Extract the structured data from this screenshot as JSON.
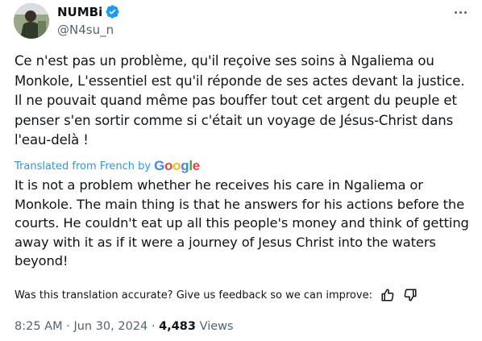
{
  "author": {
    "name": "NUMBi",
    "handle": "@N4su_n"
  },
  "tweet": {
    "original_text": "Ce n'est pas un problème, qu'il reçoive ses soins à Ngaliema ou Monkole, L'essentiel est qu'il réponde de ses actes devant la justice. Il ne pouvait quand même pas bouffer tout cet argent du peuple et penser s'en sortir comme si c'était un voyage de Jésus-Christ dans l'eau-delà !",
    "translated_from": "Translated from French by",
    "translated_text": "It is not a problem whether he receives his care in Ngaliema or Monkole. The main thing is that he answers for his actions before the courts. He couldn't eat up all this people's money and think of getting away with it as if it were a journey of Jesus Christ into the waters beyond!",
    "feedback_prompt": "Was this translation accurate? Give us feedback so we can improve:"
  },
  "meta": {
    "time": "8:25 AM",
    "sep1": " · ",
    "date": "Jun 30, 2024",
    "sep2": " · ",
    "views_count": "4,483",
    "views_label": " Views"
  },
  "icons": {
    "verified": "verified-badge-icon",
    "more": "more-options-icon",
    "thumbs_up": "thumbs-up-icon",
    "thumbs_down": "thumbs-down-icon"
  },
  "colors": {
    "accent": "#1d9bf0",
    "secondary_text": "#536471",
    "primary_text": "#0f1419"
  }
}
